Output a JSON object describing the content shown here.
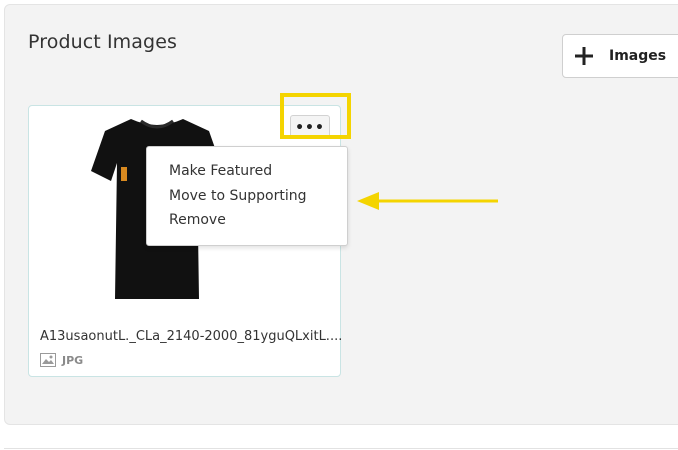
{
  "section": {
    "title": "Product Images"
  },
  "add_button": {
    "label": "Images",
    "icon": "plus-icon"
  },
  "image_card": {
    "filename": "A13usaonutL._CLa_2140-2000_81yguQLxitL....",
    "file_type": "JPG",
    "file_type_icon": "image-icon",
    "thumbnail": "black t-shirt"
  },
  "more_button": {
    "label": "•••",
    "icon": "ellipsis-icon"
  },
  "context_menu": {
    "items": [
      "Make Featured",
      "Move to Supporting",
      "Remove"
    ]
  },
  "annotation": {
    "highlight_color": "#f4d400",
    "arrow_color": "#f4d400"
  }
}
